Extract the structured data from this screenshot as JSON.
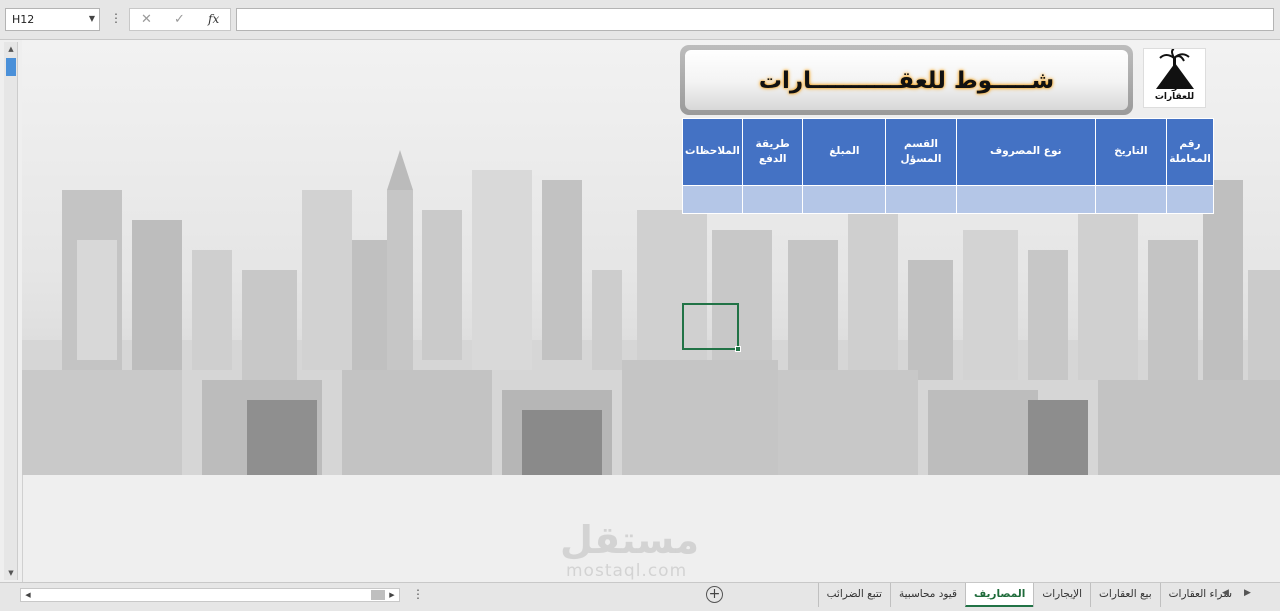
{
  "formula_bar": {
    "name_box": "H12",
    "cancel_icon": "✕",
    "enter_icon": "✓",
    "function_icon": "fx",
    "formula": ""
  },
  "header": {
    "title": "شـــــوط للعقـــــــــــارات",
    "logo_text": "شوط للعقارات"
  },
  "table": {
    "columns": [
      "رقم المعاملة",
      "التاريخ",
      "نوع المصروف",
      "القسم المسؤل",
      "المبلغ",
      "طريقة الدفع",
      "الملاحظات"
    ],
    "rows": [
      [
        "",
        "",
        "",
        "",
        "",
        "",
        ""
      ]
    ]
  },
  "sheet_tabs": [
    {
      "label": "شراء العقارات",
      "active": false
    },
    {
      "label": "بيع العقارات",
      "active": false
    },
    {
      "label": "الإيجارات",
      "active": false
    },
    {
      "label": "المصاريف",
      "active": true
    },
    {
      "label": "قيود محاسبية",
      "active": false
    },
    {
      "label": "تتبع الضرائب",
      "active": false
    }
  ],
  "watermark": {
    "text": "مستقل",
    "url": "mostaql.com"
  },
  "colors": {
    "table_header": "#4472c4",
    "table_row": "#b4c6e7",
    "selection": "#217346"
  }
}
